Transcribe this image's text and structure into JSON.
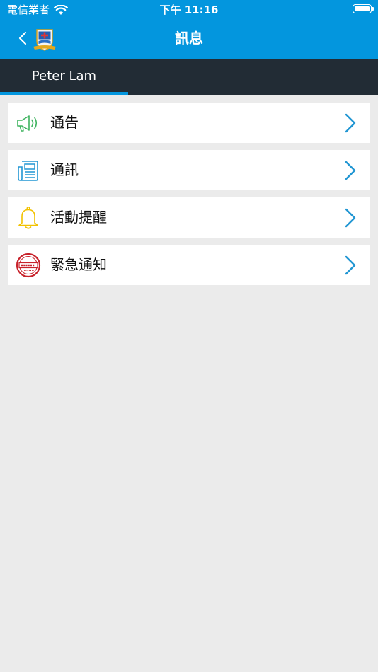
{
  "status_bar": {
    "carrier": "電信業者",
    "time": "下午 11:16"
  },
  "navbar": {
    "title": "訊息"
  },
  "tabs": [
    {
      "label": "Peter Lam",
      "active": true
    }
  ],
  "menu": [
    {
      "label": "通告",
      "icon": "megaphone-icon",
      "color": "#3eb35f"
    },
    {
      "label": "通訊",
      "icon": "newsletter-icon",
      "color": "#2196d3"
    },
    {
      "label": "活動提醒",
      "icon": "bell-icon",
      "color": "#f2c200"
    },
    {
      "label": "緊急通知",
      "icon": "urgent-stamp-icon",
      "color": "#c8232c"
    }
  ],
  "colors": {
    "header": "#0396de",
    "tabbar": "#222c35",
    "background": "#ebebeb",
    "chevron": "#2196d3"
  }
}
